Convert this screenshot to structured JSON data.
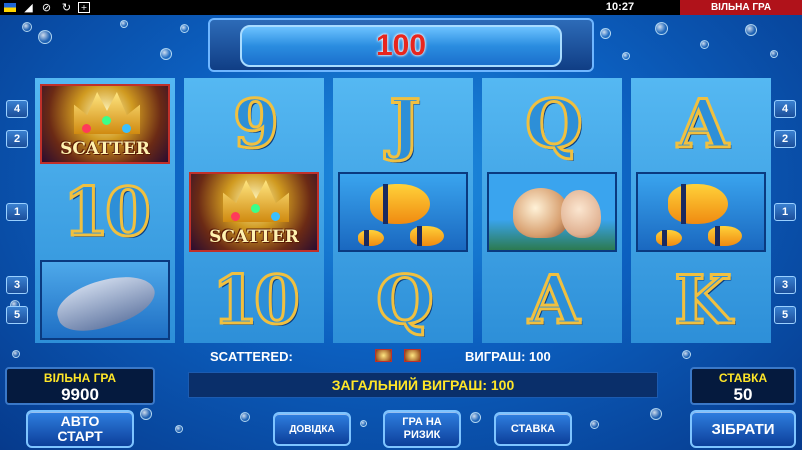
{
  "status_bar": {
    "time": "10:27",
    "mode_tab": "ВІЛЬНА ГРА",
    "icons": [
      "flag-icon",
      "speaker-icon",
      "mute-icon",
      "refresh-icon",
      "fullscreen-icon"
    ]
  },
  "win_display": {
    "value": "100"
  },
  "reels": [
    [
      "SCATTER",
      "10",
      "DOLPHIN"
    ],
    [
      "9",
      "SCATTER",
      "10"
    ],
    [
      "J",
      "FISH",
      "Q"
    ],
    [
      "Q",
      "SHELL",
      "A"
    ],
    [
      "A",
      "FISH",
      "K"
    ]
  ],
  "symbols": {
    "scatter_label": "SCATTER"
  },
  "paylines": {
    "left": [
      "4",
      "2",
      "1",
      "3",
      "5"
    ],
    "right": [
      "4",
      "2",
      "1",
      "3",
      "5"
    ]
  },
  "info": {
    "scattered_label": "SCATTERED:",
    "win_label": "ВИГРАШ: 100",
    "total_win": "ЗАГАЛЬНИЙ ВИГРАШ: 100"
  },
  "credit": {
    "label": "ВІЛЬНА ГРА",
    "value": "9900"
  },
  "bet": {
    "label": "СТАВКА",
    "value": "50"
  },
  "buttons": {
    "autostart": "АВТО СТАРТ",
    "help": "ДОВІДКА",
    "gamble": "ГРА НА РИЗИК",
    "bet": "СТАВКА",
    "collect": "ЗІБРАТИ"
  },
  "colors": {
    "background": "#0c5fbf",
    "win_value": "#e8261e",
    "label_yellow": "#ffe628",
    "mode_tab": "#b0121a"
  }
}
